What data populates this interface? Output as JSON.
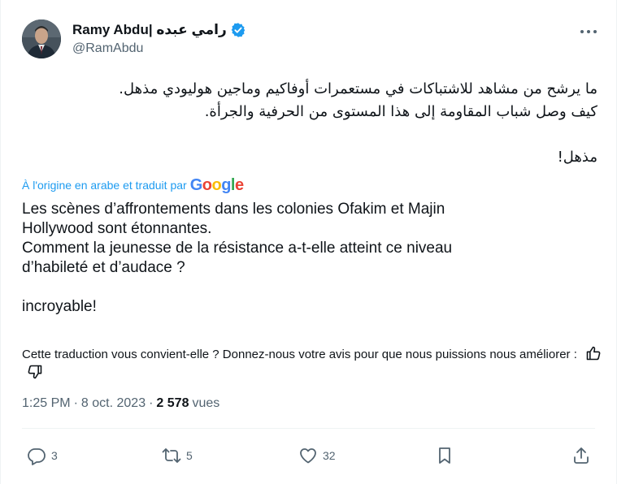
{
  "author": {
    "display_name": "Ramy Abdu| رامي عبده",
    "handle": "@RamAbdu",
    "verified": true
  },
  "tweet": {
    "arabic_lines": [
      "ما يرشح من مشاهد للاشتباكات في مستعمرات أوفاكيم وماجين هوليودي مذهل.",
      "كيف وصل شباب المقاومة إلى هذا المستوى من الحرفية والجرأة.",
      "",
      "مذهل!"
    ],
    "translated_by_label": "À l'origine en arabe et traduit par",
    "translated_by_brand": "Google",
    "translation_lines": [
      "Les scènes d’affrontements dans les colonies Ofakim et Majin",
      "Hollywood sont étonnantes.",
      "Comment la jeunesse de la résistance a-t-elle atteint ce niveau",
      "d’habileté et d’audace ?",
      "",
      "incroyable!"
    ],
    "feedback_text": "Cette traduction vous convient-elle ? Donnez-nous votre avis pour que nous puissions nous améliorer :",
    "time": "1:25 PM",
    "date": "8 oct. 2023",
    "separator": "·",
    "views_count": "2 578",
    "views_label": "vues"
  },
  "actions": {
    "replies": "3",
    "reposts": "5",
    "likes": "32"
  },
  "colors": {
    "accent": "#1d9bf0",
    "text": "#0f1419",
    "secondary": "#536471",
    "google_blue": "#4285f4",
    "google_red": "#ea4335",
    "google_yellow": "#fbbc05",
    "google_green": "#34a853"
  },
  "icons": [
    "more-icon",
    "verified-badge-icon",
    "thumbs-up-icon",
    "thumbs-down-icon",
    "reply-icon",
    "repost-icon",
    "like-icon",
    "bookmark-icon",
    "share-icon"
  ]
}
